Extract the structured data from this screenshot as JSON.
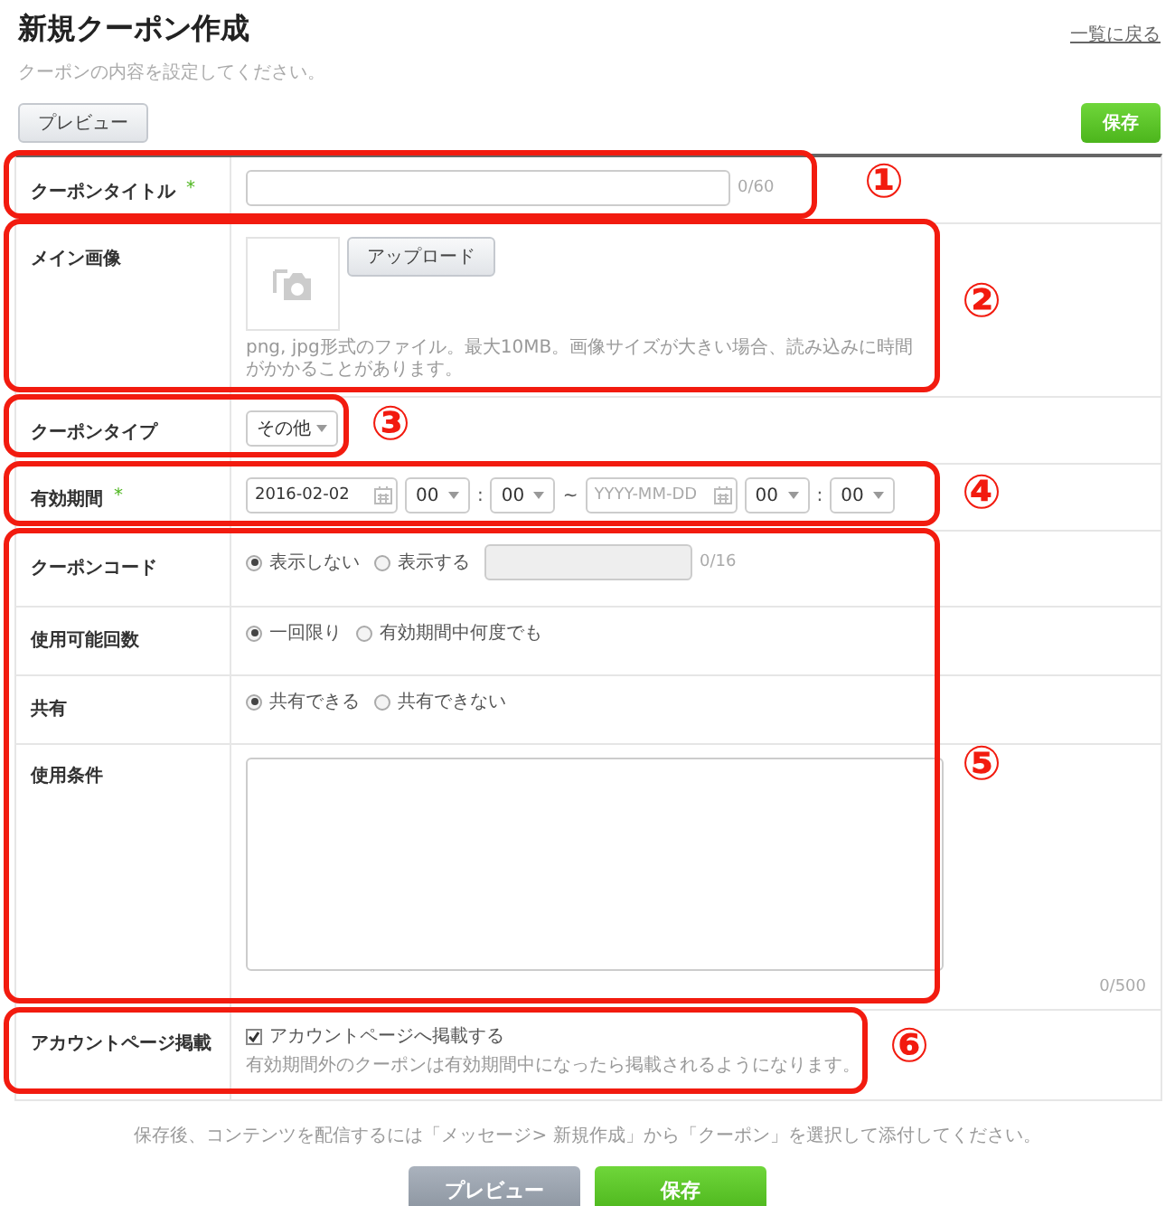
{
  "header": {
    "title": "新規クーポン作成",
    "subtitle": "クーポンの内容を設定してください。",
    "back_link": "一覧に戻る"
  },
  "toolbar": {
    "preview": "プレビュー",
    "save": "保存"
  },
  "rows": [
    {
      "kind": "text",
      "label": "クーポンタイトル",
      "required_mark": "*",
      "counter": "0/60"
    },
    {
      "kind": "image",
      "label": "メイン画像",
      "button": "アップロード",
      "hint": "png, jpg形式のファイル。最大10MB。画像サイズが大きい場合、読み込みに時間がかかることがあります。"
    },
    {
      "kind": "select",
      "label": "クーポンタイプ",
      "value": "その他"
    },
    {
      "kind": "period",
      "label": "有効期間",
      "required_mark": "*",
      "start_date": "2016-02-02",
      "start_hour": "00",
      "start_minute": "00",
      "colon": ":",
      "separator": "~",
      "end_date_placeholder": "YYYY-MM-DD",
      "end_hour": "00",
      "end_minute": "00"
    },
    {
      "kind": "radio_input",
      "label": "クーポンコード",
      "options": [
        {
          "label": "表示しない",
          "selected": true
        },
        {
          "label": "表示する",
          "selected": false
        }
      ],
      "counter": "0/16"
    },
    {
      "kind": "radio",
      "label": "使用可能回数",
      "options": [
        {
          "label": "一回限り",
          "selected": true
        },
        {
          "label": "有効期間中何度でも",
          "selected": false
        }
      ]
    },
    {
      "kind": "radio",
      "label": "共有",
      "options": [
        {
          "label": "共有できる",
          "selected": true
        },
        {
          "label": "共有できない",
          "selected": false
        }
      ]
    },
    {
      "kind": "textarea",
      "label": "使用条件",
      "counter": "0/500"
    },
    {
      "kind": "checkbox",
      "label": "アカウントページ掲載",
      "option": {
        "label": "アカウントページへ掲載する",
        "checked": true
      },
      "hint": "有効期間外のクーポンは有効期間中になったら掲載されるようになります。"
    }
  ],
  "footer": {
    "note": "保存後、コンテンツを配信するには「メッセージ> 新規作成」から「クーポン」を選択して添付してください。",
    "preview": "プレビュー",
    "save": "保存"
  },
  "annotations": [
    {
      "label": "①"
    },
    {
      "label": "②"
    },
    {
      "label": "③"
    },
    {
      "label": "④"
    },
    {
      "label": "⑤"
    },
    {
      "label": "⑥"
    }
  ]
}
